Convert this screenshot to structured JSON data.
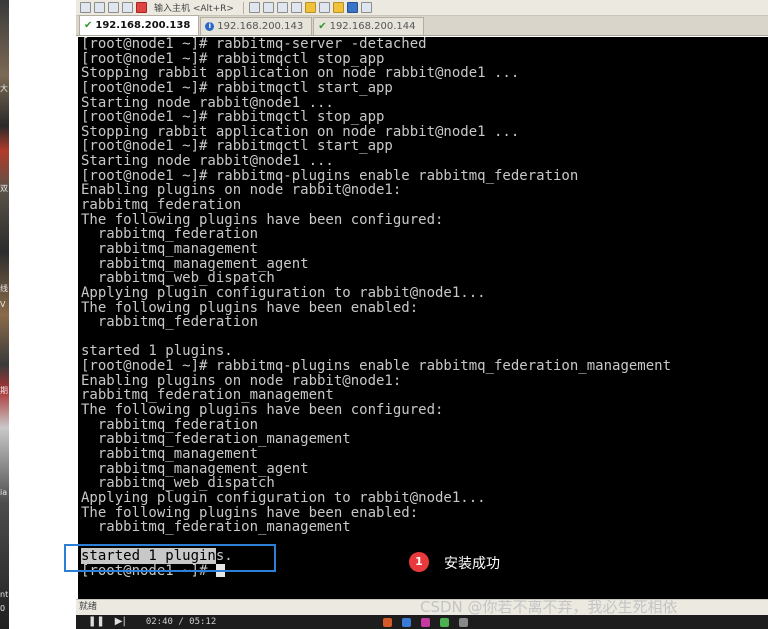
{
  "toolbar": {
    "host_input": "输入主机 <Alt+R>"
  },
  "tabs": [
    {
      "label": "192.168.200.138",
      "status": "connected"
    },
    {
      "label": "192.168.200.143",
      "status": "info"
    },
    {
      "label": "192.168.200.144",
      "status": "connected"
    }
  ],
  "terminal": {
    "lines": [
      "[root@node1 ~]# rabbitmq-server -detached",
      "[root@node1 ~]# rabbitmqctl stop_app",
      "Stopping rabbit application on node rabbit@node1 ...",
      "[root@node1 ~]# rabbitmqctl start_app",
      "Starting node rabbit@node1 ...",
      "[root@node1 ~]# rabbitmqctl stop_app",
      "Stopping rabbit application on node rabbit@node1 ...",
      "[root@node1 ~]# rabbitmqctl start_app",
      "Starting node rabbit@node1 ...",
      "[root@node1 ~]# rabbitmq-plugins enable rabbitmq_federation",
      "Enabling plugins on node rabbit@node1:",
      "rabbitmq_federation",
      "The following plugins have been configured:",
      "  rabbitmq_federation",
      "  rabbitmq_management",
      "  rabbitmq_management_agent",
      "  rabbitmq_web_dispatch",
      "Applying plugin configuration to rabbit@node1...",
      "The following plugins have been enabled:",
      "  rabbitmq_federation",
      "",
      "started 1 plugins.",
      "[root@node1 ~]# rabbitmq-plugins enable rabbitmq_federation_management",
      "Enabling plugins on node rabbit@node1:",
      "rabbitmq_federation_management",
      "The following plugins have been configured:",
      "  rabbitmq_federation",
      "  rabbitmq_federation_management",
      "  rabbitmq_management",
      "  rabbitmq_management_agent",
      "  rabbitmq_web_dispatch",
      "Applying plugin configuration to rabbit@node1...",
      "The following plugins have been enabled:",
      "  rabbitmq_federation_management",
      ""
    ],
    "selected_prefix": "started 1 plugin",
    "selected_suffix": "s.",
    "prompt": "[root@node1 ~]# "
  },
  "annotation": {
    "number": "1",
    "text": "安装成功",
    "color": "#e8393c",
    "box_color": "#2c7fd4"
  },
  "statusbar": {
    "text": "就绪"
  },
  "watermark": "CSDN @你若不离不弃，我必生死相依",
  "media": {
    "time": "02:40 / 05:12"
  }
}
